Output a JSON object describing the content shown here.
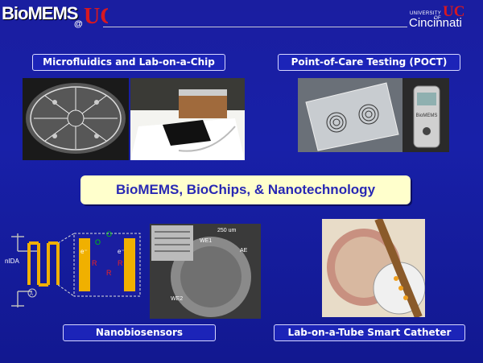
{
  "header": {
    "brand": "BioMEMS",
    "at": "@",
    "uc_monogram": "UC",
    "university_small": "UNIVERSITY OF",
    "university_name": "Cincinnati"
  },
  "sections": {
    "microfluidics": "Microfluidics and Lab-on-a-Chip",
    "poct": "Point-of-Care Testing (POCT)",
    "nanobiosensors": "Nanobiosensors",
    "catheter": "Lab-on-a-Tube Smart Catheter"
  },
  "banner": "BioMEMS, BioChips, & Nanotechnology",
  "diagram": {
    "nida": "nIDA",
    "electron": "e⁻",
    "o_label": "O",
    "r_label": "R",
    "we1": "WE1",
    "we2": "WE2",
    "ae": "AE",
    "scale": "250 um",
    "device_label": "BioMEMS"
  },
  "colors": {
    "background": "#1a1ea0",
    "banner_bg": "#ffffcc",
    "banner_text": "#2828b4",
    "uc_red": "#d81820"
  }
}
